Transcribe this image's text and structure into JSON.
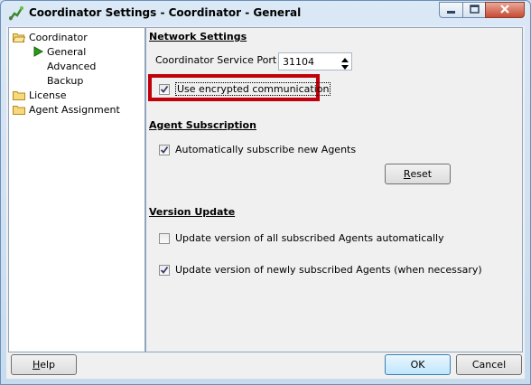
{
  "window": {
    "title": "Coordinator Settings - Coordinator - General",
    "controls": [
      "minimize-icon",
      "maximize-icon",
      "close-icon"
    ]
  },
  "tree": {
    "items": [
      {
        "label": "Coordinator",
        "icon": "folder-open-icon"
      },
      {
        "label": "General",
        "icon": "arrow-right-icon",
        "selected": true
      },
      {
        "label": "Advanced"
      },
      {
        "label": "Backup"
      },
      {
        "label": "License",
        "icon": "folder-icon"
      },
      {
        "label": "Agent Assignment",
        "icon": "folder-icon"
      }
    ]
  },
  "network": {
    "title": "Network Settings",
    "port_label": "Coordinator Service Port",
    "port_value": "31104",
    "encrypted_label": "Use encrypted communication",
    "encrypted_checked": true
  },
  "subscription": {
    "title": "Agent Subscription",
    "auto_label": "Automatically subscribe new Agents",
    "auto_checked": true,
    "reset_prefix": "",
    "reset_mnemonic": "R",
    "reset_rest": "eset"
  },
  "version": {
    "title": "Version Update",
    "all_label": "Update version of all subscribed Agents automatically",
    "all_checked": false,
    "new_label": "Update version of newly subscribed Agents (when necessary)",
    "new_checked": true
  },
  "footer": {
    "help_mnemonic": "H",
    "help_rest": "elp",
    "ok_label": "OK",
    "cancel_label": "Cancel"
  },
  "colors": {
    "highlight": "#c0000a",
    "accent_arrow": "#2a9a1a"
  }
}
